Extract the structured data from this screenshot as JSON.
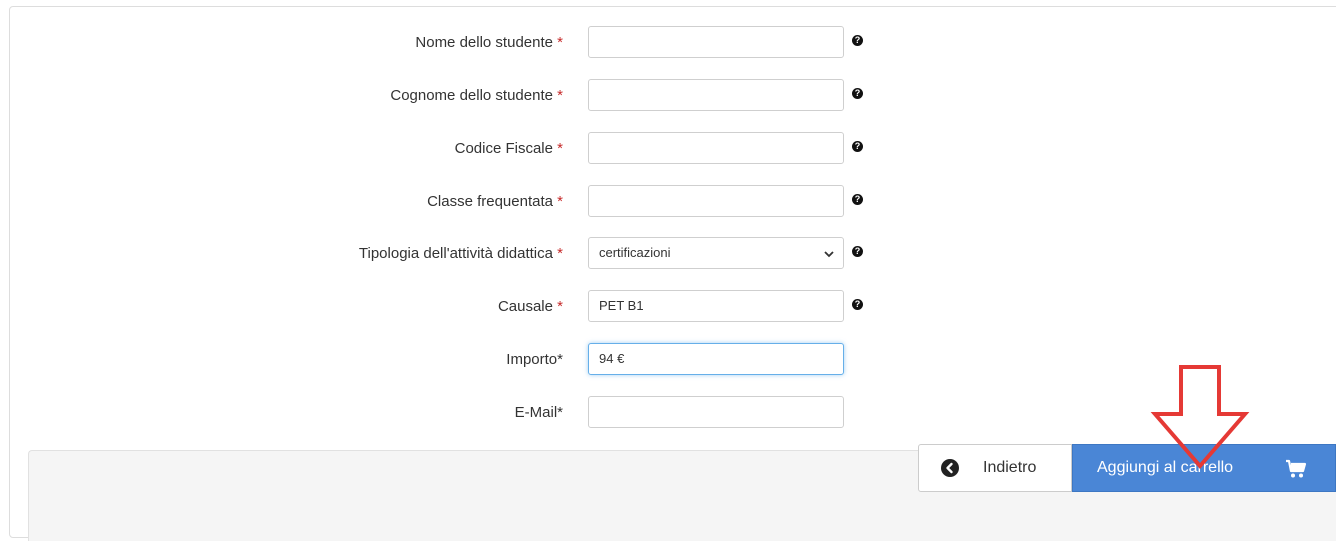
{
  "form": {
    "fields": [
      {
        "label": "Nome dello studente",
        "required_mark": "*",
        "value": "",
        "help": "?"
      },
      {
        "label": "Cognome dello studente",
        "required_mark": "*",
        "value": "",
        "help": "?"
      },
      {
        "label": "Codice Fiscale",
        "required_mark": "*",
        "value": "",
        "help": "?"
      },
      {
        "label": "Classe frequentata",
        "required_mark": "*",
        "value": "",
        "help": "?"
      },
      {
        "label": "Tipologia dell'attività didattica",
        "required_mark": "*",
        "value": "certificazioni",
        "help": "?"
      },
      {
        "label": "Causale",
        "required_mark": "*",
        "value": "PET B1",
        "help": "?"
      },
      {
        "label": "Importo*",
        "value": "94 €"
      },
      {
        "label": "E-Mail*",
        "value": ""
      }
    ]
  },
  "footer": {
    "back_label": "Indietro",
    "add_to_cart_label": "Aggiungi al carrello"
  },
  "icons": {
    "help": "question-circle-icon",
    "back": "chevron-left-circle-icon",
    "cart": "shopping-cart-icon",
    "annotation": "red-down-arrow"
  },
  "colors": {
    "primary_button": "#4a86d6",
    "required_asterisk": "#c62828",
    "annotation_arrow": "#e53935"
  }
}
